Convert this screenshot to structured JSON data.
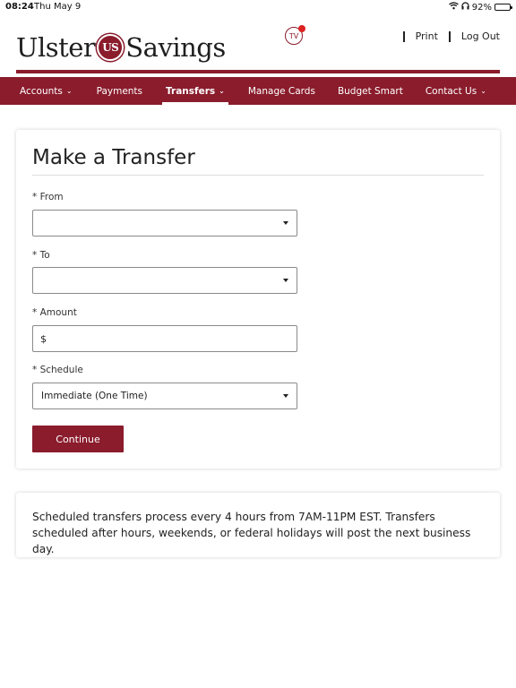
{
  "status_bar": {
    "time": "08:24",
    "date": "Thu May 9",
    "battery": "92%"
  },
  "header": {
    "logo_left": "Ulster",
    "logo_seal": "US",
    "logo_right": "Savings",
    "tv_label": "TV",
    "links": {
      "print": "Print",
      "logout": "Log Out"
    }
  },
  "nav": {
    "items": [
      {
        "label": "Accounts",
        "has_chevron": true
      },
      {
        "label": "Payments",
        "has_chevron": false
      },
      {
        "label": "Transfers",
        "has_chevron": true,
        "active": true
      },
      {
        "label": "Manage Cards",
        "has_chevron": false
      },
      {
        "label": "Budget Smart",
        "has_chevron": false
      },
      {
        "label": "Contact Us",
        "has_chevron": true
      }
    ],
    "chevron": "⌄"
  },
  "form": {
    "title": "Make a Transfer",
    "from_label": "* From",
    "from_value": "",
    "to_label": "* To",
    "to_value": "",
    "amount_label": "* Amount",
    "amount_prefix": "$",
    "schedule_label": "* Schedule",
    "schedule_value": "Immediate (One Time)",
    "submit_label": "Continue"
  },
  "info": {
    "text": "Scheduled transfers process every 4 hours from 7AM-11PM EST. Transfers scheduled after hours, weekends, or federal holidays will post the next business day."
  },
  "colors": {
    "brand": "#8a1c2c",
    "notification": "#dd2222"
  }
}
